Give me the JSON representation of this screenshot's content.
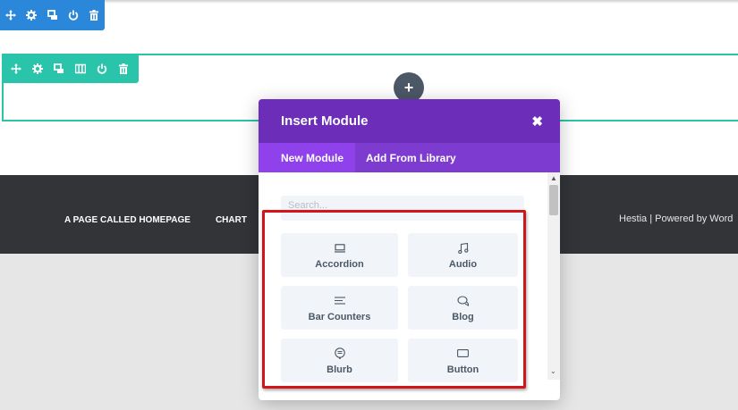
{
  "section_toolbar": {
    "color": "#2b87da",
    "icons": [
      "move-icon",
      "gear-icon",
      "duplicate-icon",
      "power-icon",
      "trash-icon"
    ]
  },
  "row_toolbar": {
    "color": "#29c4a9",
    "icons": [
      "move-icon",
      "gear-icon",
      "duplicate-icon",
      "columns-icon",
      "power-icon",
      "trash-icon"
    ]
  },
  "add_button": {
    "label": "+"
  },
  "footer": {
    "nav": [
      "A PAGE CALLED HOMEPAGE",
      "CHART"
    ],
    "credit": "Hestia | Powered by Word"
  },
  "modal": {
    "title": "Insert Module",
    "close": "✖",
    "tabs": [
      {
        "label": "New Module",
        "active": true
      },
      {
        "label": "Add From Library",
        "active": false
      }
    ],
    "search_placeholder": "Search...",
    "modules": [
      {
        "label": "Accordion",
        "icon": "accordion-icon"
      },
      {
        "label": "Audio",
        "icon": "music-note-icon"
      },
      {
        "label": "Bar Counters",
        "icon": "bar-counters-icon"
      },
      {
        "label": "Blog",
        "icon": "chat-bubbles-icon"
      },
      {
        "label": "Blurb",
        "icon": "speech-bubble-icon"
      },
      {
        "label": "Button",
        "icon": "button-icon"
      }
    ]
  },
  "colors": {
    "modal_header": "#6c2eb9",
    "modal_tabs": "#7e3bd0",
    "active_tab": "#8f42ec",
    "highlight": "#d0161b",
    "footer_bg": "#323437"
  }
}
